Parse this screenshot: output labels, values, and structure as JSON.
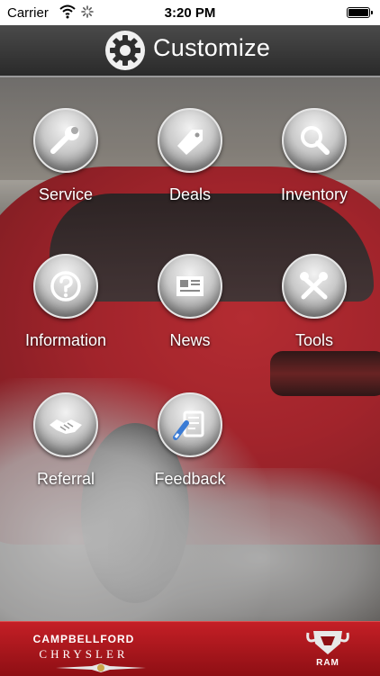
{
  "status_bar": {
    "carrier": "Carrier",
    "time": "3:20 PM"
  },
  "header": {
    "title": "Customize",
    "icon": "gear-icon"
  },
  "menu": [
    {
      "label": "Service",
      "icon": "wrench-icon"
    },
    {
      "label": "Deals",
      "icon": "tag-icon"
    },
    {
      "label": "Inventory",
      "icon": "search-icon"
    },
    {
      "label": "Information",
      "icon": "question-icon"
    },
    {
      "label": "News",
      "icon": "newspaper-icon"
    },
    {
      "label": "Tools",
      "icon": "tools-icon"
    },
    {
      "label": "Referral",
      "icon": "handshake-icon"
    },
    {
      "label": "Feedback",
      "icon": "feedback-icon"
    }
  ],
  "footer": {
    "dealer_line1": "CAMPBELLFORD",
    "dealer_line2": "CHRYSLER",
    "brand": "RAM"
  },
  "colors": {
    "header_bg": "#2f2f2f",
    "footer_red": "#b81820",
    "button_silver": "#c9c9c9"
  }
}
